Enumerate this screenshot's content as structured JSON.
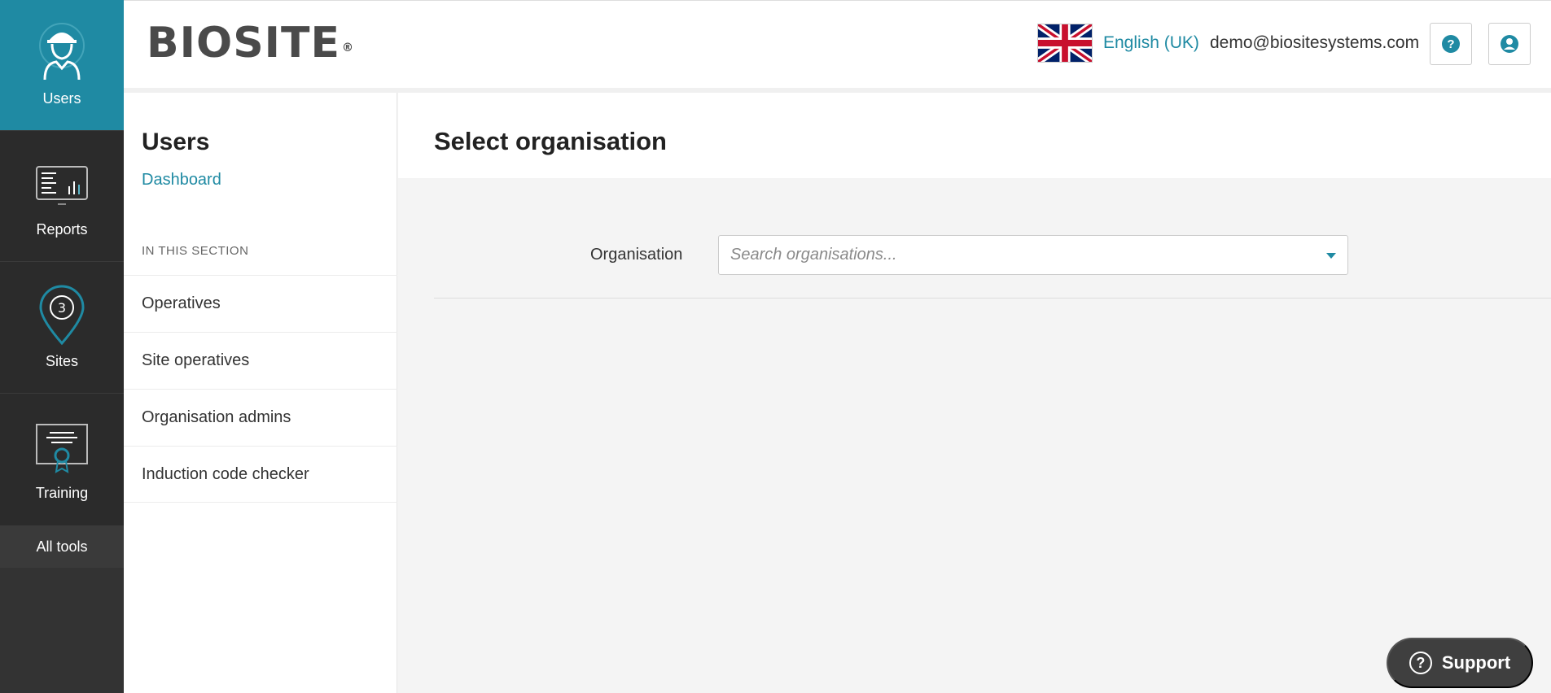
{
  "rail": {
    "items": [
      {
        "label": "Users",
        "icon": "worker-icon"
      },
      {
        "label": "Reports",
        "icon": "report-icon"
      },
      {
        "label": "Sites",
        "icon": "location-pin-icon"
      },
      {
        "label": "Training",
        "icon": "certificate-icon"
      }
    ],
    "all_tools": "All tools"
  },
  "header": {
    "logo": "BIOSITE",
    "logo_mark": "®",
    "language": "English (UK)",
    "email": "demo@biositesystems.com",
    "help_icon": "?",
    "account_icon": "account-icon"
  },
  "subnav": {
    "title": "Users",
    "dashboard": "Dashboard",
    "section_label": "IN THIS SECTION",
    "items": [
      "Operatives",
      "Site operatives",
      "Organisation admins",
      "Induction code checker"
    ]
  },
  "main": {
    "title": "Select organisation",
    "field_label": "Organisation",
    "search_placeholder": "Search organisations..."
  },
  "support": {
    "label": "Support",
    "icon": "?"
  },
  "colors": {
    "accent": "#1f8aa3",
    "rail_bg": "#2b2b2b"
  }
}
